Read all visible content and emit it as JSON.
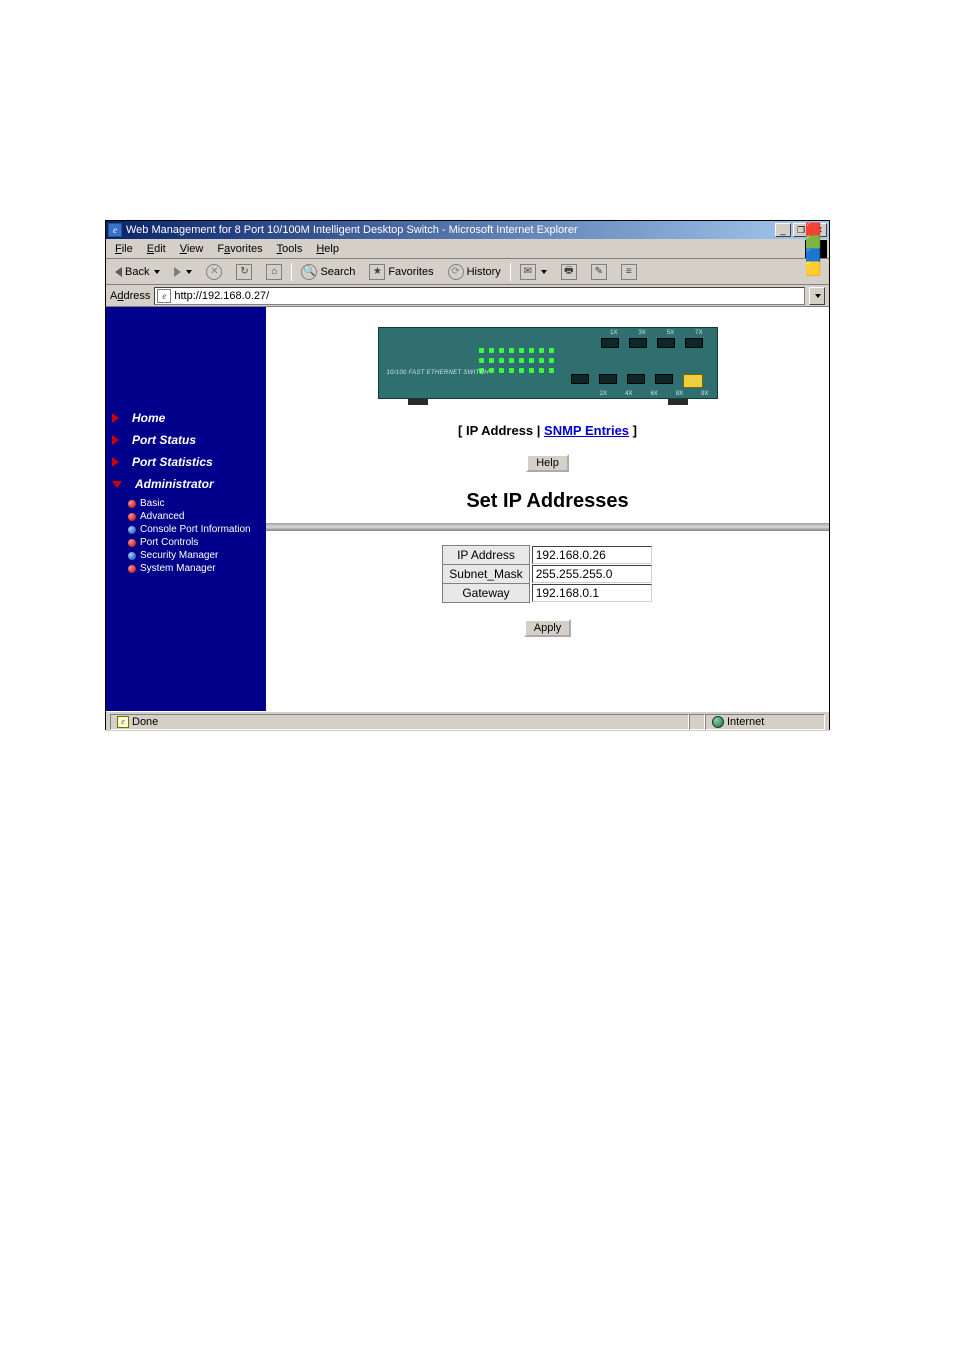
{
  "window": {
    "title": "Web Management for 8 Port 10/100M Intelligent Desktop Switch - Microsoft Internet Explorer",
    "min": "_",
    "max": "❐",
    "close": "✕"
  },
  "menu": {
    "file": "File",
    "edit": "Edit",
    "view": "View",
    "favorites": "Favorites",
    "tools": "Tools",
    "help": "Help"
  },
  "toolbar": {
    "back": "Back",
    "search": "Search",
    "favorites": "Favorites",
    "history": "History"
  },
  "addressbar": {
    "label": "Address",
    "url": "http://192.168.0.27/"
  },
  "sidebar": {
    "items": [
      {
        "label": "Home",
        "expanded": false
      },
      {
        "label": "Port Status",
        "expanded": false
      },
      {
        "label": "Port Statistics",
        "expanded": false
      },
      {
        "label": "Administrator",
        "expanded": true
      }
    ],
    "admin_sub": [
      "Basic",
      "Advanced",
      "Console Port Information",
      "Port Controls",
      "Security Manager",
      "System Manager"
    ]
  },
  "switch_img": {
    "label": "10/100 FAST ETHERNET SWITCH",
    "top_nums": [
      "1X",
      "3X",
      "5X",
      "7X"
    ],
    "bot_nums": [
      "2X",
      "4X",
      "6X",
      "8X",
      "9X"
    ]
  },
  "tabs": {
    "open": "[ ",
    "ip": "IP Address",
    "sep": " | ",
    "snmp": "SNMP Entries",
    "close": " ]"
  },
  "buttons": {
    "help": "Help",
    "apply": "Apply"
  },
  "heading": "Set IP Addresses",
  "form": {
    "ip": {
      "label": "IP Address",
      "value": "192.168.0.26"
    },
    "mask": {
      "label": "Subnet_Mask",
      "value": "255.255.255.0"
    },
    "gw": {
      "label": "Gateway",
      "value": "192.168.0.1"
    }
  },
  "status": {
    "done": "Done",
    "zone": "Internet"
  }
}
